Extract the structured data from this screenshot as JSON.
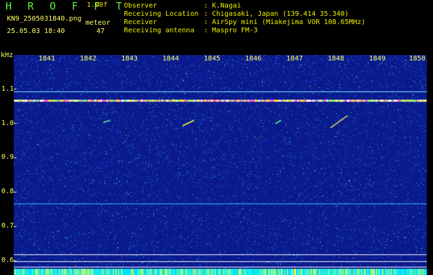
{
  "header": {
    "app_title": "H R O F F T",
    "version": "1.00f",
    "filename": "KN9_2505031840.png",
    "datetime": "25.05.03 18:40",
    "meteor_label": "meteor",
    "meteor_count": "47"
  },
  "info": [
    {
      "key": "Observer",
      "sep": ":",
      "value": "K.Nagai"
    },
    {
      "key": "Receiving Location",
      "sep": ":",
      "value": "Chigasaki, Japan (139.414 35.340)"
    },
    {
      "key": "Receiver",
      "sep": ":",
      "value": "AirSpy mini (Miakejima VOR 108.65MHz)"
    },
    {
      "key": "Receiving antenna",
      "sep": ":",
      "value": "Maspro FM-3"
    }
  ],
  "axis": {
    "unit": "kHz",
    "y_ticks": [
      "1.1",
      "1.0",
      "0.9",
      "0.8",
      "0.7",
      "0.6"
    ],
    "x_ticks": [
      "1841",
      "1842",
      "1843",
      "1844",
      "1845",
      "1846",
      "1847",
      "1848",
      "1849",
      "1850"
    ]
  },
  "colors": {
    "background": "#0a1a8c",
    "label": "#ffff66",
    "title": "#5cf23a"
  }
}
